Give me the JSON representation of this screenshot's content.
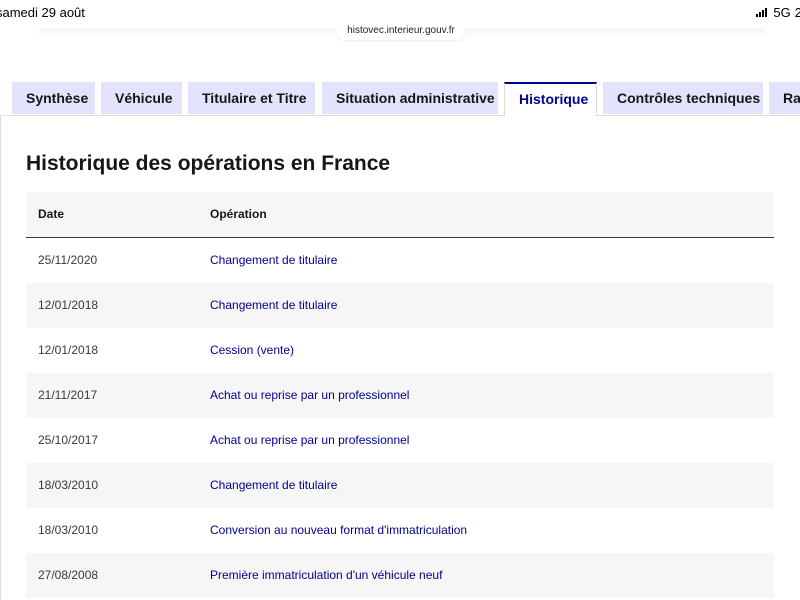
{
  "status": {
    "date": "samedi 29 août",
    "network": "5G",
    "time": "2"
  },
  "browser": {
    "url": "histovec.interieur.gouv.fr"
  },
  "tabs": [
    {
      "label": "Synthèse",
      "active": false
    },
    {
      "label": "Véhicule",
      "active": false
    },
    {
      "label": "Titulaire et Titre",
      "active": false
    },
    {
      "label": "Situation administrative",
      "active": false
    },
    {
      "label": "Historique",
      "active": true
    },
    {
      "label": "Contrôles techniques",
      "active": false
    },
    {
      "label": "Rap",
      "active": false
    }
  ],
  "page": {
    "title": "Historique des opérations en France"
  },
  "table": {
    "headers": {
      "date": "Date",
      "operation": "Opération"
    },
    "rows": [
      {
        "date": "25/11/2020",
        "operation": "Changement de titulaire"
      },
      {
        "date": "12/01/2018",
        "operation": "Changement de titulaire"
      },
      {
        "date": "12/01/2018",
        "operation": "Cession (vente)"
      },
      {
        "date": "21/11/2017",
        "operation": "Achat ou reprise par un professionnel"
      },
      {
        "date": "25/10/2017",
        "operation": "Achat ou reprise par un professionnel"
      },
      {
        "date": "18/03/2010",
        "operation": "Changement de titulaire"
      },
      {
        "date": "18/03/2010",
        "operation": "Conversion au nouveau format d'immatriculation"
      },
      {
        "date": "27/08/2008",
        "operation": "Première immatriculation d'un véhicule neuf"
      }
    ]
  },
  "colors": {
    "accent": "#000091",
    "tab_bg": "#e3e3fd",
    "row_alt": "#f6f6f6"
  }
}
